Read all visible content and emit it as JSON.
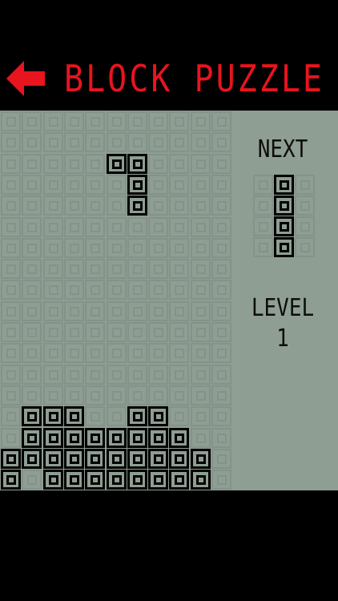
{
  "header": {
    "title": "BLOCK PUZZLE",
    "back_icon": "back-arrow-icon",
    "accent_color": "#e8141e"
  },
  "board": {
    "columns": 11,
    "rows": 18,
    "filled_color": "#000000",
    "empty_color": "#84938a",
    "background": "#8f9e93",
    "falling_piece": [
      [
        2,
        5
      ],
      [
        2,
        6
      ],
      [
        3,
        6
      ],
      [
        4,
        6
      ]
    ],
    "settled": [
      [
        14,
        1
      ],
      [
        14,
        2
      ],
      [
        14,
        3
      ],
      [
        14,
        6
      ],
      [
        14,
        7
      ],
      [
        15,
        1
      ],
      [
        15,
        2
      ],
      [
        15,
        3
      ],
      [
        15,
        4
      ],
      [
        15,
        5
      ],
      [
        15,
        6
      ],
      [
        15,
        7
      ],
      [
        15,
        8
      ],
      [
        16,
        0
      ],
      [
        16,
        1
      ],
      [
        16,
        2
      ],
      [
        16,
        3
      ],
      [
        16,
        4
      ],
      [
        16,
        5
      ],
      [
        16,
        6
      ],
      [
        16,
        7
      ],
      [
        16,
        8
      ],
      [
        16,
        9
      ],
      [
        17,
        0
      ],
      [
        17,
        2
      ],
      [
        17,
        3
      ],
      [
        17,
        4
      ],
      [
        17,
        5
      ],
      [
        17,
        6
      ],
      [
        17,
        7
      ],
      [
        17,
        8
      ],
      [
        17,
        9
      ]
    ]
  },
  "next": {
    "label": "NEXT",
    "columns": 3,
    "rows": 4,
    "cells": [
      [
        0,
        1
      ],
      [
        1,
        1
      ],
      [
        2,
        1
      ],
      [
        3,
        1
      ]
    ]
  },
  "level": {
    "label": "LEVEL",
    "value": "1"
  }
}
